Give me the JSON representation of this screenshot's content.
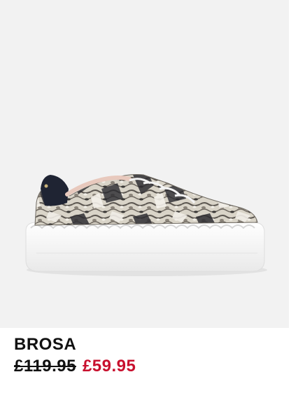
{
  "product": {
    "name": "BROSA",
    "price_was": "£119.95",
    "price_now": "£59.95",
    "image_icon": "snakeskin-sneaker-photo"
  },
  "colors": {
    "image_background": "#f2f2f2",
    "name_text": "#111111",
    "sale_price": "#c8102e"
  }
}
